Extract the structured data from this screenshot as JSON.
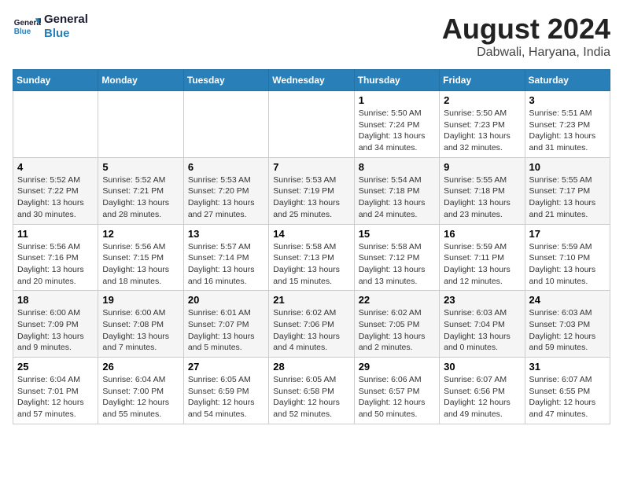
{
  "header": {
    "logo_line1": "General",
    "logo_line2": "Blue",
    "month": "August 2024",
    "location": "Dabwali, Haryana, India"
  },
  "weekdays": [
    "Sunday",
    "Monday",
    "Tuesday",
    "Wednesday",
    "Thursday",
    "Friday",
    "Saturday"
  ],
  "weeks": [
    [
      {
        "day": "",
        "info": ""
      },
      {
        "day": "",
        "info": ""
      },
      {
        "day": "",
        "info": ""
      },
      {
        "day": "",
        "info": ""
      },
      {
        "day": "1",
        "info": "Sunrise: 5:50 AM\nSunset: 7:24 PM\nDaylight: 13 hours and 34 minutes."
      },
      {
        "day": "2",
        "info": "Sunrise: 5:50 AM\nSunset: 7:23 PM\nDaylight: 13 hours and 32 minutes."
      },
      {
        "day": "3",
        "info": "Sunrise: 5:51 AM\nSunset: 7:23 PM\nDaylight: 13 hours and 31 minutes."
      }
    ],
    [
      {
        "day": "4",
        "info": "Sunrise: 5:52 AM\nSunset: 7:22 PM\nDaylight: 13 hours and 30 minutes."
      },
      {
        "day": "5",
        "info": "Sunrise: 5:52 AM\nSunset: 7:21 PM\nDaylight: 13 hours and 28 minutes."
      },
      {
        "day": "6",
        "info": "Sunrise: 5:53 AM\nSunset: 7:20 PM\nDaylight: 13 hours and 27 minutes."
      },
      {
        "day": "7",
        "info": "Sunrise: 5:53 AM\nSunset: 7:19 PM\nDaylight: 13 hours and 25 minutes."
      },
      {
        "day": "8",
        "info": "Sunrise: 5:54 AM\nSunset: 7:18 PM\nDaylight: 13 hours and 24 minutes."
      },
      {
        "day": "9",
        "info": "Sunrise: 5:55 AM\nSunset: 7:18 PM\nDaylight: 13 hours and 23 minutes."
      },
      {
        "day": "10",
        "info": "Sunrise: 5:55 AM\nSunset: 7:17 PM\nDaylight: 13 hours and 21 minutes."
      }
    ],
    [
      {
        "day": "11",
        "info": "Sunrise: 5:56 AM\nSunset: 7:16 PM\nDaylight: 13 hours and 20 minutes."
      },
      {
        "day": "12",
        "info": "Sunrise: 5:56 AM\nSunset: 7:15 PM\nDaylight: 13 hours and 18 minutes."
      },
      {
        "day": "13",
        "info": "Sunrise: 5:57 AM\nSunset: 7:14 PM\nDaylight: 13 hours and 16 minutes."
      },
      {
        "day": "14",
        "info": "Sunrise: 5:58 AM\nSunset: 7:13 PM\nDaylight: 13 hours and 15 minutes."
      },
      {
        "day": "15",
        "info": "Sunrise: 5:58 AM\nSunset: 7:12 PM\nDaylight: 13 hours and 13 minutes."
      },
      {
        "day": "16",
        "info": "Sunrise: 5:59 AM\nSunset: 7:11 PM\nDaylight: 13 hours and 12 minutes."
      },
      {
        "day": "17",
        "info": "Sunrise: 5:59 AM\nSunset: 7:10 PM\nDaylight: 13 hours and 10 minutes."
      }
    ],
    [
      {
        "day": "18",
        "info": "Sunrise: 6:00 AM\nSunset: 7:09 PM\nDaylight: 13 hours and 9 minutes."
      },
      {
        "day": "19",
        "info": "Sunrise: 6:00 AM\nSunset: 7:08 PM\nDaylight: 13 hours and 7 minutes."
      },
      {
        "day": "20",
        "info": "Sunrise: 6:01 AM\nSunset: 7:07 PM\nDaylight: 13 hours and 5 minutes."
      },
      {
        "day": "21",
        "info": "Sunrise: 6:02 AM\nSunset: 7:06 PM\nDaylight: 13 hours and 4 minutes."
      },
      {
        "day": "22",
        "info": "Sunrise: 6:02 AM\nSunset: 7:05 PM\nDaylight: 13 hours and 2 minutes."
      },
      {
        "day": "23",
        "info": "Sunrise: 6:03 AM\nSunset: 7:04 PM\nDaylight: 13 hours and 0 minutes."
      },
      {
        "day": "24",
        "info": "Sunrise: 6:03 AM\nSunset: 7:03 PM\nDaylight: 12 hours and 59 minutes."
      }
    ],
    [
      {
        "day": "25",
        "info": "Sunrise: 6:04 AM\nSunset: 7:01 PM\nDaylight: 12 hours and 57 minutes."
      },
      {
        "day": "26",
        "info": "Sunrise: 6:04 AM\nSunset: 7:00 PM\nDaylight: 12 hours and 55 minutes."
      },
      {
        "day": "27",
        "info": "Sunrise: 6:05 AM\nSunset: 6:59 PM\nDaylight: 12 hours and 54 minutes."
      },
      {
        "day": "28",
        "info": "Sunrise: 6:05 AM\nSunset: 6:58 PM\nDaylight: 12 hours and 52 minutes."
      },
      {
        "day": "29",
        "info": "Sunrise: 6:06 AM\nSunset: 6:57 PM\nDaylight: 12 hours and 50 minutes."
      },
      {
        "day": "30",
        "info": "Sunrise: 6:07 AM\nSunset: 6:56 PM\nDaylight: 12 hours and 49 minutes."
      },
      {
        "day": "31",
        "info": "Sunrise: 6:07 AM\nSunset: 6:55 PM\nDaylight: 12 hours and 47 minutes."
      }
    ]
  ]
}
